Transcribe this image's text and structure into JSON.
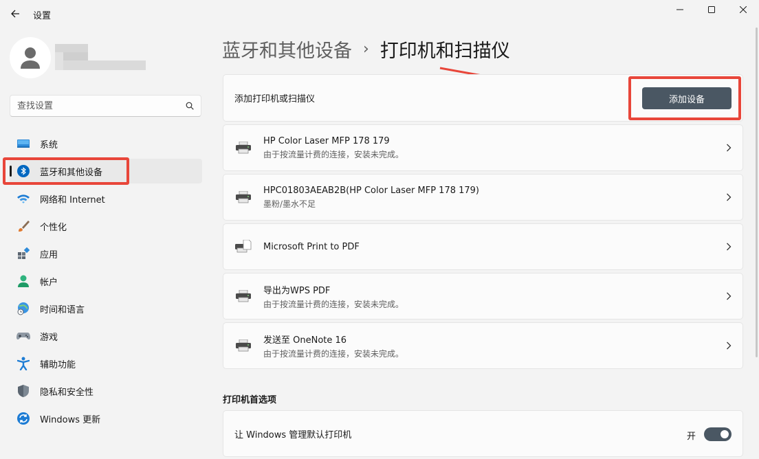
{
  "window": {
    "title": "设置"
  },
  "sidebar": {
    "search_placeholder": "查找设置",
    "items": [
      {
        "label": "系统",
        "icon": "monitor-icon"
      },
      {
        "label": "蓝牙和其他设备",
        "icon": "bluetooth-icon",
        "active": true
      },
      {
        "label": "网络和 Internet",
        "icon": "wifi-icon"
      },
      {
        "label": "个性化",
        "icon": "brush-icon"
      },
      {
        "label": "应用",
        "icon": "apps-icon"
      },
      {
        "label": "帐户",
        "icon": "person-icon"
      },
      {
        "label": "时间和语言",
        "icon": "globe-clock-icon"
      },
      {
        "label": "游戏",
        "icon": "gamepad-icon"
      },
      {
        "label": "辅助功能",
        "icon": "accessibility-icon"
      },
      {
        "label": "隐私和安全性",
        "icon": "shield-icon"
      },
      {
        "label": "Windows 更新",
        "icon": "update-icon"
      }
    ]
  },
  "main": {
    "breadcrumb": {
      "parent": "蓝牙和其他设备",
      "separator": "›",
      "current": "打印机和扫描仪"
    },
    "add_card": {
      "label": "添加打印机或扫描仪",
      "button": "添加设备"
    },
    "devices": [
      {
        "name": "HP Color Laser MFP 178 179",
        "status": "由于按流量计费的连接，安装未完成。"
      },
      {
        "name": "HPC01803AEAB2B(HP Color Laser MFP 178 179)",
        "status": "墨粉/墨水不足"
      },
      {
        "name": "Microsoft Print to PDF",
        "status": ""
      },
      {
        "name": "导出为WPS PDF",
        "status": "由于按流量计费的连接，安装未完成。"
      },
      {
        "name": "发送至 OneNote 16",
        "status": "由于按流量计费的连接，安装未完成。"
      }
    ],
    "preferences": {
      "title": "打印机首选项",
      "default_printer_label": "让 Windows 管理默认打印机",
      "toggle_state": "开",
      "toggle_on": true
    }
  },
  "colors": {
    "accent": "#4a5763",
    "annotation": "#e8463a",
    "bluetooth": "#0067c0"
  }
}
